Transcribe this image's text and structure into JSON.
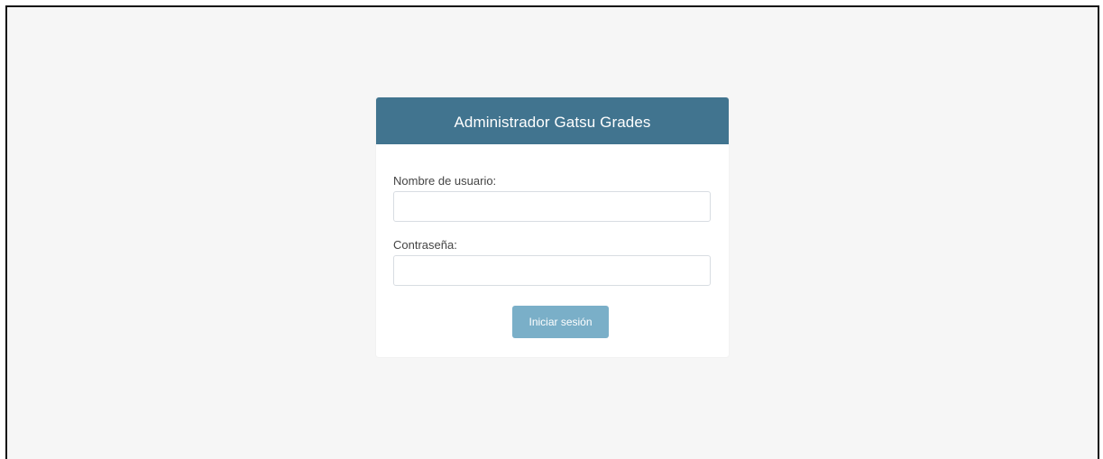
{
  "login": {
    "title": "Administrador Gatsu Grades",
    "username_label": "Nombre de usuario:",
    "username_value": "",
    "password_label": "Contraseña:",
    "password_value": "",
    "submit_label": "Iniciar sesión"
  },
  "colors": {
    "background": "#f6f6f6",
    "header": "#41748f",
    "button": "#7aafc8",
    "card": "#ffffff"
  }
}
